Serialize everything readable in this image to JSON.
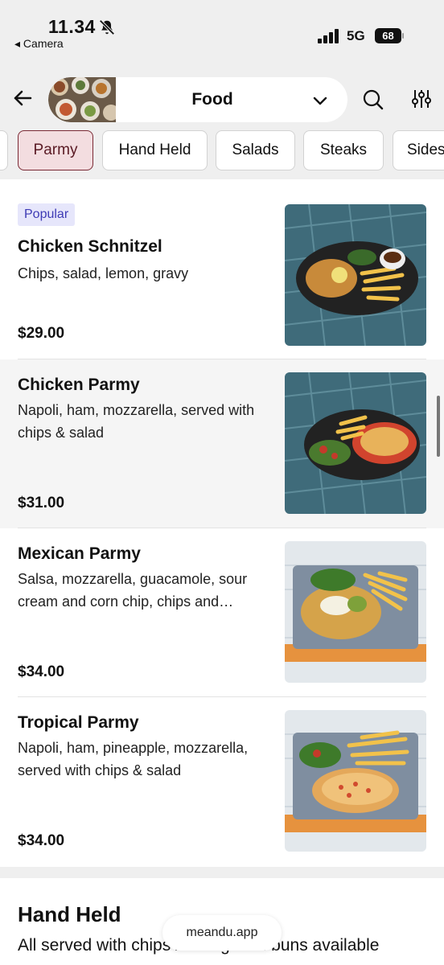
{
  "status_bar": {
    "time": "11.34",
    "back_label": "◂ Camera",
    "network": "5G",
    "battery": "68"
  },
  "header": {
    "menu_title": "Food"
  },
  "tabs": [
    {
      "label": ""
    },
    {
      "label": "Parmy"
    },
    {
      "label": "Hand Held"
    },
    {
      "label": "Salads"
    },
    {
      "label": "Steaks"
    },
    {
      "label": "Sides"
    }
  ],
  "items": [
    {
      "badge": "Popular",
      "name": "Chicken Schnitzel",
      "desc": "Chips, salad, lemon, gravy",
      "price": "$29.00"
    },
    {
      "name": "Chicken Parmy",
      "desc": "Napoli, ham, mozzarella, served with chips & salad",
      "price": "$31.00"
    },
    {
      "name": "Mexican Parmy",
      "desc": "Salsa, mozzarella, guacamole, sour cream and corn chip, chips and…",
      "price": "$34.00"
    },
    {
      "name": "Tropical Parmy",
      "desc": "Napoli, ham, pineapple, mozzarella, served with chips & salad",
      "price": "$34.00"
    }
  ],
  "section": {
    "title": "Hand Held",
    "desc": "All served with chips / Low gluten buns available"
  },
  "url": "meandu.app",
  "colors": {
    "active_tab_bg": "#f3dde0",
    "active_tab_border": "#7a2a35",
    "badge_bg": "#e6e6fb",
    "badge_text": "#3e3bb5"
  }
}
